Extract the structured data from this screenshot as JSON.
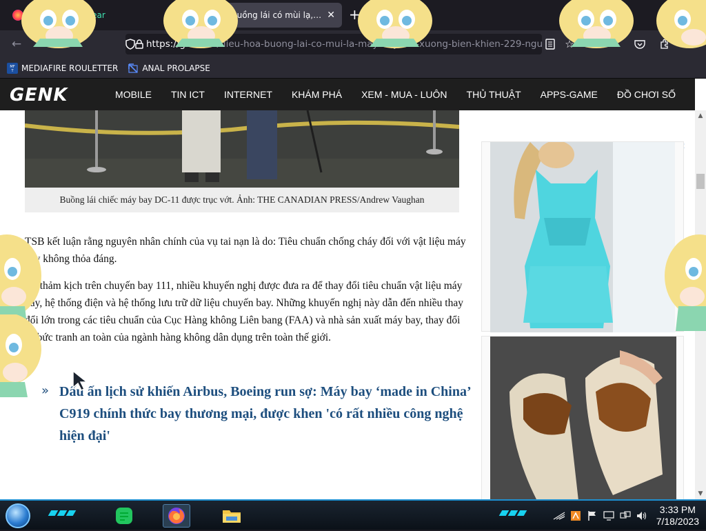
{
  "browser": {
    "tabs": [
      {
        "title_prefix": "",
        "title_green": "k.vn - Google Sear",
        "active": false
      },
      {
        "title": "buồng lái có mùi lạ, m",
        "active": true
      }
    ],
    "new_tab_symbol": "+",
    "url_host": "https://genk.vn",
    "url_path": "/dieu-hoa-buong-lai-co-mui-la-may-bay-lao-xuong-bien-khien-229-ngu",
    "icons": [
      "back-icon",
      "forward-icon",
      "reload-icon",
      "shield-icon",
      "lock-icon",
      "reader-view-icon",
      "bookmark-star-icon",
      "pocket-icon",
      "extensions-icon",
      "menu-icon"
    ],
    "bookmarks": [
      {
        "label": "MEDIAFIRE ROULETTER",
        "icon": "mediafire-icon"
      },
      {
        "label": "ANAL PROLAPSE",
        "icon": "folder-icon"
      }
    ]
  },
  "site": {
    "logo_text": "GENK",
    "menu": [
      "MOBILE",
      "TIN ICT",
      "INTERNET",
      "KHÁM PHÁ",
      "XEM - MUA - LUÔN",
      "THỦ THUẬT",
      "APPS-GAME",
      "ĐỒ CHƠI SỐ"
    ]
  },
  "article": {
    "caption": "Buồng lái chiếc máy bay DC-11 được trục vớt. Ảnh: THE CANADIAN PRESS/Andrew Vaughan",
    "paragraph_1": "TSB kết luận rằng nguyên nhân chính của vụ tai nạn là do: Tiêu chuẩn chống cháy đối với vật liệu máy bay không thỏa đáng.",
    "paragraph_2": "Từ thảm kịch trên chuyến bay 111, nhiều khuyến nghị được đưa ra để thay đổi tiêu chuẩn vật liệu máy bay, hệ thống điện và hệ thống lưu trữ dữ liệu chuyến bay. Những khuyến nghị này dẫn đến nhiều thay đổi lớn trong các tiêu chuẩn của Cục Hàng không Liên bang (FAA) và nhà sản xuất máy bay, thay đổi cả bức tranh an toàn của ngành hàng không dân dụng trên toàn thế giới.",
    "related_arrow": "»",
    "related_link": "Dấu ấn lịch sử khiến Airbus, Boeing run sợ: Máy bay ‘made in China’ C919 chính thức bay thương mại, được khen 'có rất nhiều công nghệ hiện đại'"
  },
  "ads": {
    "info_symbol": "ⓘ",
    "close_symbol": "✕"
  },
  "taskbar": {
    "time": "3:33 PM",
    "date": "7/18/2023",
    "apps": [
      "notes-app-icon",
      "firefox-icon",
      "file-explorer-icon"
    ],
    "tray_icons": [
      "show-hidden-icon",
      "app-tray-icon",
      "flag-icon",
      "display-icon",
      "network-icon",
      "volume-icon"
    ]
  }
}
